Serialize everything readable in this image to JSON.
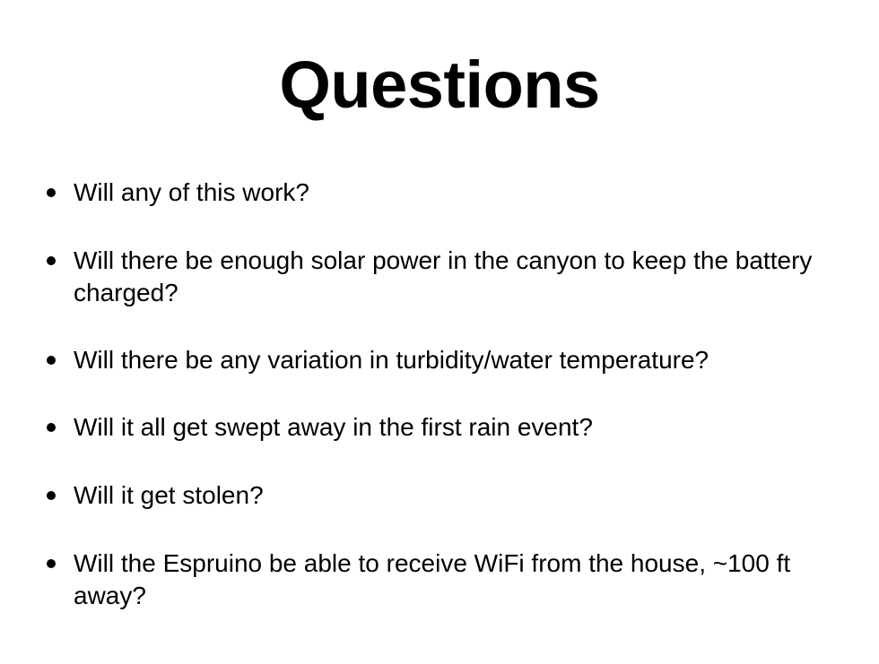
{
  "slide": {
    "title": "Questions",
    "bullets": [
      "Will any of this work?",
      "Will there be enough solar power in the canyon to keep the battery charged?",
      "Will there be any variation in turbidity/water temperature?",
      "Will it all get swept away in the first rain event?",
      "Will it get stolen?",
      "Will the Espruino be able to receive WiFi from the house, ~100 ft away?"
    ]
  },
  "colors": {
    "background": "#ffffff",
    "text": "#000000"
  }
}
